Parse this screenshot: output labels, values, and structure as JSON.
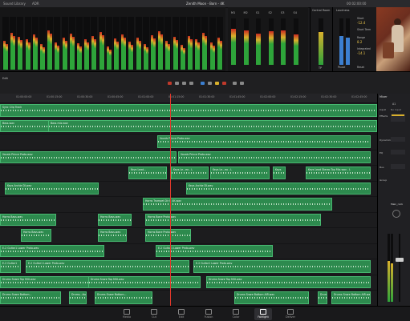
{
  "app": {
    "project_title": "Zenith Moon - Born - 4K",
    "left_menu": "Sound Library",
    "left_menu2": "ADR",
    "timecode": "00:02:00:00"
  },
  "meters": {
    "count": 30,
    "levels": [
      0.55,
      0.7,
      0.62,
      0.58,
      0.66,
      0.48,
      0.74,
      0.52,
      0.61,
      0.68,
      0.5,
      0.57,
      0.63,
      0.71,
      0.44,
      0.59,
      0.67,
      0.53,
      0.6,
      0.49,
      0.65,
      0.72,
      0.55,
      0.62,
      0.47,
      0.64,
      0.58,
      0.69,
      0.51,
      0.6
    ]
  },
  "bus_meters": {
    "labels": [
      "M1",
      "M2",
      "S1",
      "S2",
      "S3",
      "S4"
    ],
    "levels": [
      0.78,
      0.74,
      0.68,
      0.72,
      0.75,
      0.66
    ]
  },
  "control_room": {
    "title": "Control Room",
    "label": "TP"
  },
  "loudness": {
    "title": "Loudness",
    "short_label": "Short",
    "short_value": "-12.4",
    "short_term_label": "Short Term",
    "range_label": "Range",
    "range_value": "8.2",
    "integrated_label": "Integrated",
    "integrated_value": "-14.1",
    "pause": "Pause",
    "reset": "Reset"
  },
  "toolbar": {
    "left_label": "Edit"
  },
  "ruler": {
    "marks": [
      "01:00:00:00",
      "01:00:15:00",
      "01:00:30:00",
      "01:00:45:00",
      "01:01:00:00",
      "01:01:15:00",
      "01:01:30:00",
      "01:01:45:00",
      "01:02:00:00",
      "01:02:15:00",
      "01:02:30:00",
      "01:02:45:00"
    ]
  },
  "clips": [
    {
      "lane": 0,
      "start": 0,
      "end": 470,
      "name": "Sync Clip Track"
    },
    {
      "lane": 1,
      "start": 0,
      "end": 470,
      "name": "Bass.wav"
    },
    {
      "lane": 1,
      "start": 60,
      "end": 470,
      "name": "Bass mix.wav"
    },
    {
      "lane": 2,
      "start": 196,
      "end": 462,
      "name": "Vocals Prince Proto.wav"
    },
    {
      "lane": 3,
      "start": 0,
      "end": 220,
      "name": "Vocals Prince Proto.wav"
    },
    {
      "lane": 3,
      "start": 222,
      "end": 462,
      "name": "Vocals Prince Proto.wav"
    },
    {
      "lane": 4,
      "start": 160,
      "end": 208,
      "name": "Keys Lead..."
    },
    {
      "lane": 4,
      "start": 213,
      "end": 260,
      "name": "Keys Le...eo - L"
    },
    {
      "lane": 4,
      "start": 262,
      "end": 336,
      "name": "Keys Le...eo - L"
    },
    {
      "lane": 4,
      "start": 340,
      "end": 356,
      "name": "Keys"
    },
    {
      "lane": 4,
      "start": 381,
      "end": 462,
      "name": "Keys Lead Stereo Top Mix.wav - L"
    },
    {
      "lane": 5,
      "start": 6,
      "end": 123,
      "name": "Keys Archie DI.wav"
    },
    {
      "lane": 5,
      "start": 232,
      "end": 462,
      "name": "Keys Archie DI.wav"
    },
    {
      "lane": 6,
      "start": 178,
      "end": 414,
      "name": "Horns Trumpet Dir R 4K.wav"
    },
    {
      "lane": 7,
      "start": 0,
      "end": 70,
      "name": "Horns Bass.wav"
    },
    {
      "lane": 7,
      "start": 122,
      "end": 164,
      "name": "Horns Bass.wav"
    },
    {
      "lane": 7,
      "start": 181,
      "end": 400,
      "name": "Horns Bone Proto.wav"
    },
    {
      "lane": 8,
      "start": 26,
      "end": 64,
      "name": "Horns Bass.wav"
    },
    {
      "lane": 8,
      "start": 122,
      "end": 158,
      "name": "Horns Bass.wav"
    },
    {
      "lane": 8,
      "start": 181,
      "end": 238,
      "name": "Horns Bone Proto.wav"
    },
    {
      "lane": 9,
      "start": 0,
      "end": 130,
      "name": "E-2 Guitar1 Lower Proto.wav"
    },
    {
      "lane": 9,
      "start": 194,
      "end": 340,
      "name": "E-2 Guitar1 Lower Proto.wav"
    },
    {
      "lane": 10,
      "start": 0,
      "end": 26,
      "name": "E-2 Guitar1"
    },
    {
      "lane": 10,
      "start": 32,
      "end": 236,
      "name": "E-2 Guitar1 Lower Proto.wav"
    },
    {
      "lane": 10,
      "start": 241,
      "end": 462,
      "name": "E-2 Guitar1 Lower Proto.wav"
    },
    {
      "lane": 11,
      "start": 0,
      "end": 160,
      "name": "Drums Snare Top MIX.wav"
    },
    {
      "lane": 11,
      "start": 110,
      "end": 250,
      "name": "Drums Snare Top MIX.wav"
    },
    {
      "lane": 11,
      "start": 257,
      "end": 462,
      "name": "Drums Snare Top MIX.wav"
    },
    {
      "lane": 12,
      "start": 0,
      "end": 76,
      "name": "Drums Snare Bottom..."
    },
    {
      "lane": 12,
      "start": 86,
      "end": 108,
      "name": "Drums...ttom.wav"
    },
    {
      "lane": 12,
      "start": 118,
      "end": 190,
      "name": "Drums Snare Bottom..."
    },
    {
      "lane": 12,
      "start": 292,
      "end": 385,
      "name": "Drums Snare Bottom AIR.wav"
    },
    {
      "lane": 12,
      "start": 396,
      "end": 408,
      "name": "Drums"
    },
    {
      "lane": 12,
      "start": 413,
      "end": 462,
      "name": "Drums Snare Bottom AIR.wav"
    }
  ],
  "mixer": {
    "title": "Mixer",
    "channel_name": "A1",
    "input_label": "Input",
    "input_value": "No Input",
    "effects_label": "Effects",
    "dynamics_label": "Dynamics",
    "eq_label": "EQ",
    "bus_label": "Bus",
    "group_label": "Group",
    "track_name": "Main_rock"
  },
  "pages": [
    "Media",
    "Cut",
    "Edit",
    "Fusion",
    "Color",
    "Fairlight",
    "Deliver"
  ],
  "active_page": "Fairlight",
  "colors": {
    "clip": "#2d8a4e",
    "clip_border": "#47b870",
    "playhead": "#e0382b",
    "accent": "#d9b02c"
  }
}
